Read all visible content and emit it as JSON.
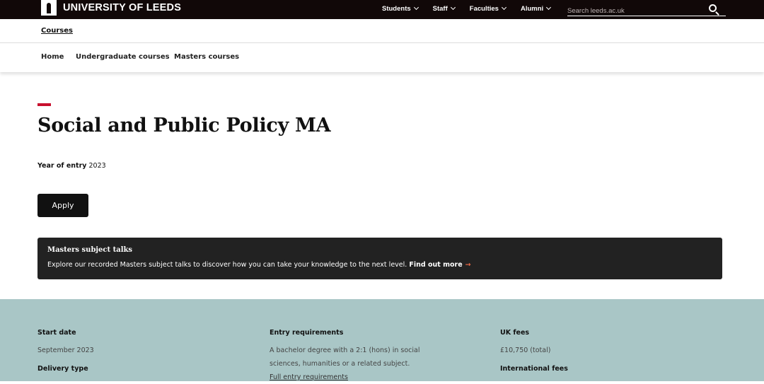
{
  "header": {
    "logo_text": "UNIVERSITY OF LEEDS",
    "nav": [
      "Students",
      "Staff",
      "Faculties",
      "Alumni"
    ],
    "search_placeholder": "Search leeds.ac.uk"
  },
  "breadcrumb": {
    "courses": "Courses"
  },
  "subnav": [
    "Home",
    "Undergraduate courses",
    "Masters courses"
  ],
  "page": {
    "title": "Social and Public Policy MA",
    "year_label": "Year of entry",
    "year_value": "2023",
    "apply_label": "Apply"
  },
  "talks": {
    "title": "Masters subject talks",
    "body": "Explore our recorded Masters subject talks to discover how you can take your knowledge to the next level.",
    "link": "Find out more",
    "arrow": "→"
  },
  "facts": {
    "start_label": "Start date",
    "start_value": "September 2023",
    "delivery_label": "Delivery type",
    "entry_label": "Entry requirements",
    "entry_line1": "A bachelor degree with a 2:1 (hons) in social",
    "entry_line2": "sciences, humanities or a related subject.",
    "entry_link": "Full entry requirements",
    "uk_label": "UK fees",
    "uk_value": "£10,750 (total)",
    "intl_label": "International fees"
  }
}
